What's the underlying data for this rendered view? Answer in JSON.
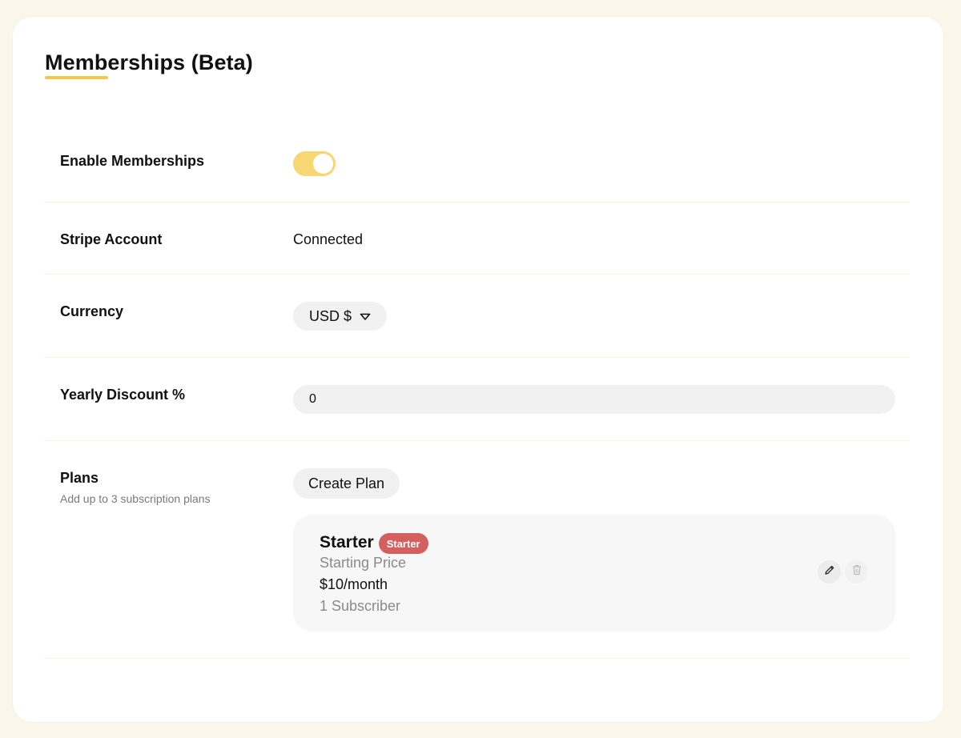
{
  "page": {
    "title": "Memberships (Beta)"
  },
  "settings": {
    "enable_memberships": {
      "label": "Enable Memberships",
      "enabled": true
    },
    "stripe_account": {
      "label": "Stripe Account",
      "value": "Connected"
    },
    "currency": {
      "label": "Currency",
      "selected": "USD $"
    },
    "yearly_discount": {
      "label": "Yearly Discount %",
      "value": "0"
    },
    "plans": {
      "label": "Plans",
      "sublabel": "Add up to 3 subscription plans",
      "create_label": "Create Plan",
      "items": [
        {
          "name": "Starter",
          "badge": "Starter",
          "price_label": "Starting Price",
          "price": "$10/month",
          "subscribers": "1 Subscriber"
        }
      ]
    }
  },
  "colors": {
    "accent": "#f7d773",
    "underline": "#f2c94c",
    "badge": "#d35f5f",
    "background": "#faf6ea"
  },
  "icons": {
    "currency_dropdown": "chevron-down-icon",
    "edit": "pencil-icon",
    "delete": "trash-icon"
  }
}
